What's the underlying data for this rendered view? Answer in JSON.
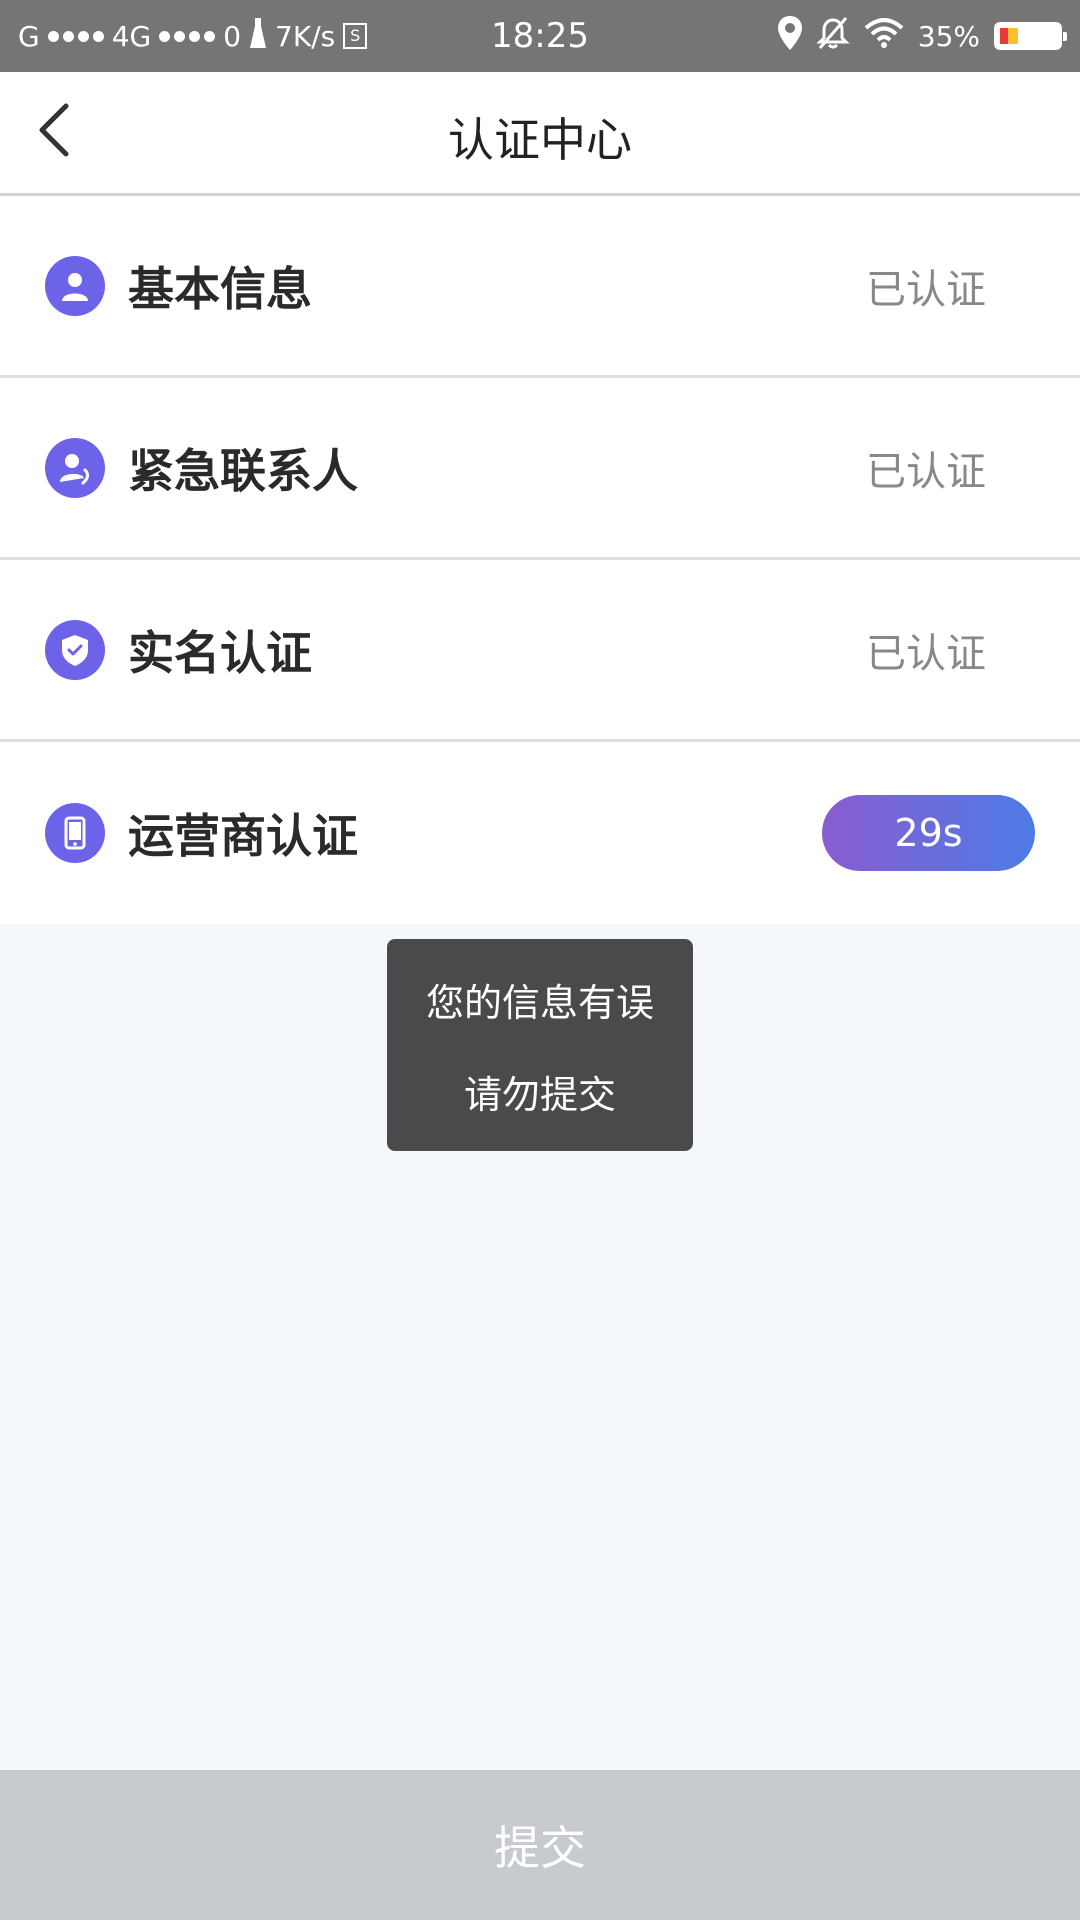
{
  "status_bar": {
    "carrier1": "G",
    "network": "4G",
    "data_zero": "0",
    "speed": "7K/s",
    "sim_label": "S",
    "time": "18:25",
    "battery": "35%"
  },
  "nav": {
    "title": "认证中心"
  },
  "rows": [
    {
      "label": "基本信息",
      "status": "已认证",
      "icon": "user-icon"
    },
    {
      "label": "紧急联系人",
      "status": "已认证",
      "icon": "contact-phone-icon"
    },
    {
      "label": "实名认证",
      "status": "已认证",
      "icon": "shield-check-icon"
    },
    {
      "label": "运营商认证",
      "countdown": "29s",
      "icon": "mobile-phone-icon"
    }
  ],
  "toast": {
    "line1": "您的信息有误",
    "line2": "请勿提交"
  },
  "submit_label": "提交",
  "colors": {
    "accent": "#6c63e8",
    "gradient_start": "#8a5cd1",
    "gradient_end": "#4c7be6",
    "submit_bg": "#c7cacf"
  }
}
